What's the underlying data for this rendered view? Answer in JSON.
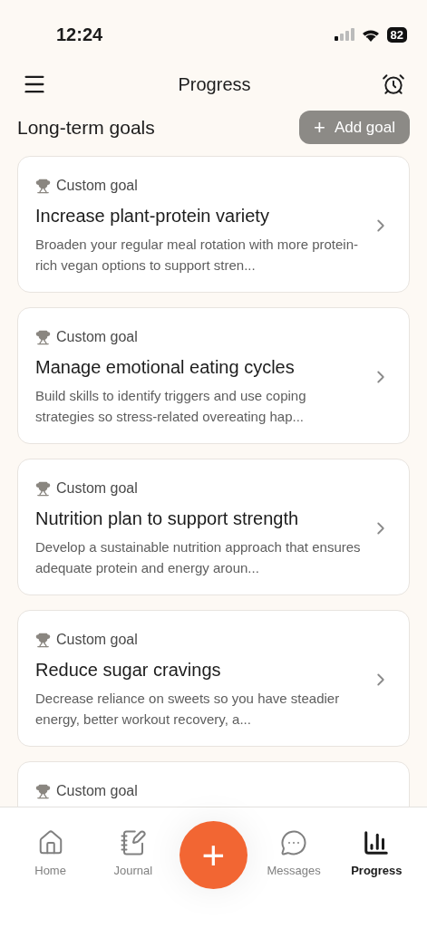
{
  "status_bar": {
    "time": "12:24",
    "battery": "82"
  },
  "header": {
    "title": "Progress"
  },
  "section": {
    "title": "Long-term goals",
    "add_button": {
      "icon": "+",
      "label": "Add goal"
    }
  },
  "goals": [
    {
      "kicker": "Custom goal",
      "title": "Increase plant-protein variety",
      "description": "Broaden your regular meal rotation with more protein-rich vegan options to support stren..."
    },
    {
      "kicker": "Custom goal",
      "title": "Manage emotional eating cycles",
      "description": "Build skills to identify triggers and use coping strategies so stress-related overeating hap..."
    },
    {
      "kicker": "Custom goal",
      "title": "Nutrition plan to support strength",
      "description": "Develop a sustainable nutrition approach that ensures adequate protein and energy aroun..."
    },
    {
      "kicker": "Custom goal",
      "title": "Reduce sugar cravings",
      "description": "Decrease reliance on sweets so you have steadier energy, better workout recovery, a..."
    },
    {
      "kicker": "Custom goal"
    }
  ],
  "nav": [
    {
      "kind": "home",
      "label": "Home",
      "selected": false
    },
    {
      "kind": "journal",
      "label": "Journal",
      "selected": false
    },
    {
      "kind": "fab",
      "icon": "+"
    },
    {
      "kind": "messages",
      "label": "Messages",
      "selected": false
    },
    {
      "kind": "progress",
      "label": "Progress",
      "selected": true
    }
  ]
}
